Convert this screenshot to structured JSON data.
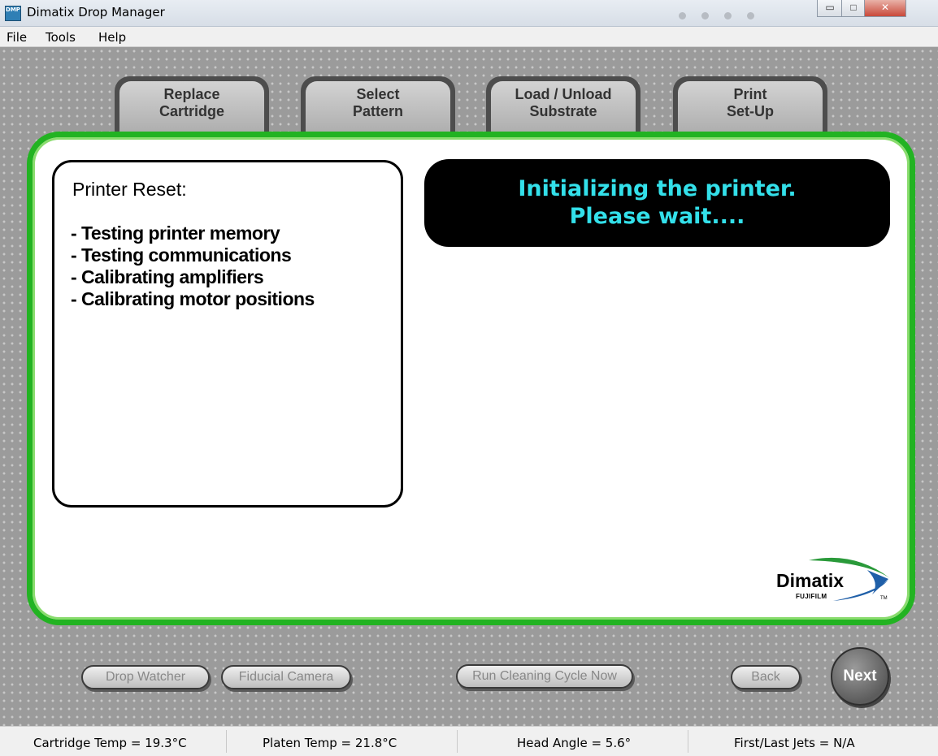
{
  "window": {
    "title": "Dimatix Drop Manager",
    "icon_label": "DMP",
    "buttons": {
      "minimize": "▭",
      "maximize": "□",
      "close": "✕"
    }
  },
  "menubar": [
    "File",
    "Tools",
    "Help"
  ],
  "tabs": [
    {
      "line1": "Replace",
      "line2": "Cartridge"
    },
    {
      "line1": "Select",
      "line2": "Pattern"
    },
    {
      "line1": "Load / Unload",
      "line2": "Substrate"
    },
    {
      "line1": "Print",
      "line2": "Set-Up"
    }
  ],
  "panel": {
    "reset_title": "Printer Reset:",
    "reset_items": [
      "- Testing printer memory",
      "- Testing communications",
      "- Calibrating amplifiers",
      "- Calibrating motor positions"
    ],
    "status_line1": "Initializing the printer.",
    "status_line2": "Please wait....",
    "logo_name": "Dimatix",
    "logo_sub": "FUJIFILM",
    "logo_tm": "TM"
  },
  "bottom_buttons": {
    "drop_watcher": "Drop Watcher",
    "fiducial_camera": "Fiducial Camera",
    "run_cleaning": "Run Cleaning Cycle Now",
    "back": "Back",
    "next": "Next"
  },
  "statusbar": {
    "cartridge_temp": "Cartridge Temp = 19.3°C",
    "platen_temp": "Platen Temp = 21.8°C",
    "head_angle": "Head Angle = 5.6°",
    "jets": "First/Last Jets = N/A"
  },
  "colors": {
    "panel_border": "#22b322",
    "status_text": "#33e0ea",
    "background": "#9b9b9b"
  }
}
